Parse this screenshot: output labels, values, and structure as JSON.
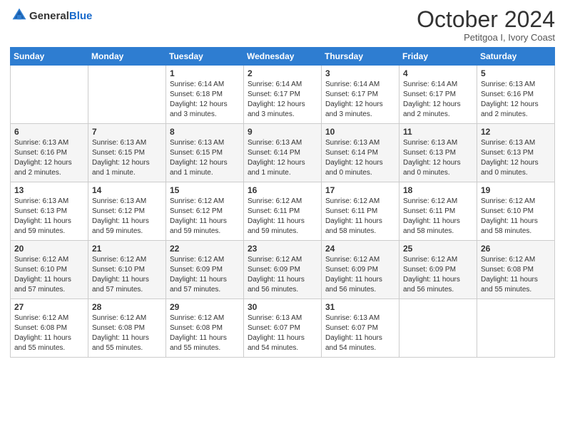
{
  "header": {
    "logo_general": "General",
    "logo_blue": "Blue",
    "month_year": "October 2024",
    "subtitle": "Petitgoa I, Ivory Coast"
  },
  "days_of_week": [
    "Sunday",
    "Monday",
    "Tuesday",
    "Wednesday",
    "Thursday",
    "Friday",
    "Saturday"
  ],
  "weeks": [
    [
      {
        "day": "",
        "info": ""
      },
      {
        "day": "",
        "info": ""
      },
      {
        "day": "1",
        "info": "Sunrise: 6:14 AM\nSunset: 6:18 PM\nDaylight: 12 hours and 3 minutes."
      },
      {
        "day": "2",
        "info": "Sunrise: 6:14 AM\nSunset: 6:17 PM\nDaylight: 12 hours and 3 minutes."
      },
      {
        "day": "3",
        "info": "Sunrise: 6:14 AM\nSunset: 6:17 PM\nDaylight: 12 hours and 3 minutes."
      },
      {
        "day": "4",
        "info": "Sunrise: 6:14 AM\nSunset: 6:17 PM\nDaylight: 12 hours and 2 minutes."
      },
      {
        "day": "5",
        "info": "Sunrise: 6:13 AM\nSunset: 6:16 PM\nDaylight: 12 hours and 2 minutes."
      }
    ],
    [
      {
        "day": "6",
        "info": "Sunrise: 6:13 AM\nSunset: 6:16 PM\nDaylight: 12 hours and 2 minutes."
      },
      {
        "day": "7",
        "info": "Sunrise: 6:13 AM\nSunset: 6:15 PM\nDaylight: 12 hours and 1 minute."
      },
      {
        "day": "8",
        "info": "Sunrise: 6:13 AM\nSunset: 6:15 PM\nDaylight: 12 hours and 1 minute."
      },
      {
        "day": "9",
        "info": "Sunrise: 6:13 AM\nSunset: 6:14 PM\nDaylight: 12 hours and 1 minute."
      },
      {
        "day": "10",
        "info": "Sunrise: 6:13 AM\nSunset: 6:14 PM\nDaylight: 12 hours and 0 minutes."
      },
      {
        "day": "11",
        "info": "Sunrise: 6:13 AM\nSunset: 6:13 PM\nDaylight: 12 hours and 0 minutes."
      },
      {
        "day": "12",
        "info": "Sunrise: 6:13 AM\nSunset: 6:13 PM\nDaylight: 12 hours and 0 minutes."
      }
    ],
    [
      {
        "day": "13",
        "info": "Sunrise: 6:13 AM\nSunset: 6:13 PM\nDaylight: 11 hours and 59 minutes."
      },
      {
        "day": "14",
        "info": "Sunrise: 6:13 AM\nSunset: 6:12 PM\nDaylight: 11 hours and 59 minutes."
      },
      {
        "day": "15",
        "info": "Sunrise: 6:12 AM\nSunset: 6:12 PM\nDaylight: 11 hours and 59 minutes."
      },
      {
        "day": "16",
        "info": "Sunrise: 6:12 AM\nSunset: 6:11 PM\nDaylight: 11 hours and 59 minutes."
      },
      {
        "day": "17",
        "info": "Sunrise: 6:12 AM\nSunset: 6:11 PM\nDaylight: 11 hours and 58 minutes."
      },
      {
        "day": "18",
        "info": "Sunrise: 6:12 AM\nSunset: 6:11 PM\nDaylight: 11 hours and 58 minutes."
      },
      {
        "day": "19",
        "info": "Sunrise: 6:12 AM\nSunset: 6:10 PM\nDaylight: 11 hours and 58 minutes."
      }
    ],
    [
      {
        "day": "20",
        "info": "Sunrise: 6:12 AM\nSunset: 6:10 PM\nDaylight: 11 hours and 57 minutes."
      },
      {
        "day": "21",
        "info": "Sunrise: 6:12 AM\nSunset: 6:10 PM\nDaylight: 11 hours and 57 minutes."
      },
      {
        "day": "22",
        "info": "Sunrise: 6:12 AM\nSunset: 6:09 PM\nDaylight: 11 hours and 57 minutes."
      },
      {
        "day": "23",
        "info": "Sunrise: 6:12 AM\nSunset: 6:09 PM\nDaylight: 11 hours and 56 minutes."
      },
      {
        "day": "24",
        "info": "Sunrise: 6:12 AM\nSunset: 6:09 PM\nDaylight: 11 hours and 56 minutes."
      },
      {
        "day": "25",
        "info": "Sunrise: 6:12 AM\nSunset: 6:09 PM\nDaylight: 11 hours and 56 minutes."
      },
      {
        "day": "26",
        "info": "Sunrise: 6:12 AM\nSunset: 6:08 PM\nDaylight: 11 hours and 55 minutes."
      }
    ],
    [
      {
        "day": "27",
        "info": "Sunrise: 6:12 AM\nSunset: 6:08 PM\nDaylight: 11 hours and 55 minutes."
      },
      {
        "day": "28",
        "info": "Sunrise: 6:12 AM\nSunset: 6:08 PM\nDaylight: 11 hours and 55 minutes."
      },
      {
        "day": "29",
        "info": "Sunrise: 6:12 AM\nSunset: 6:08 PM\nDaylight: 11 hours and 55 minutes."
      },
      {
        "day": "30",
        "info": "Sunrise: 6:13 AM\nSunset: 6:07 PM\nDaylight: 11 hours and 54 minutes."
      },
      {
        "day": "31",
        "info": "Sunrise: 6:13 AM\nSunset: 6:07 PM\nDaylight: 11 hours and 54 minutes."
      },
      {
        "day": "",
        "info": ""
      },
      {
        "day": "",
        "info": ""
      }
    ]
  ]
}
